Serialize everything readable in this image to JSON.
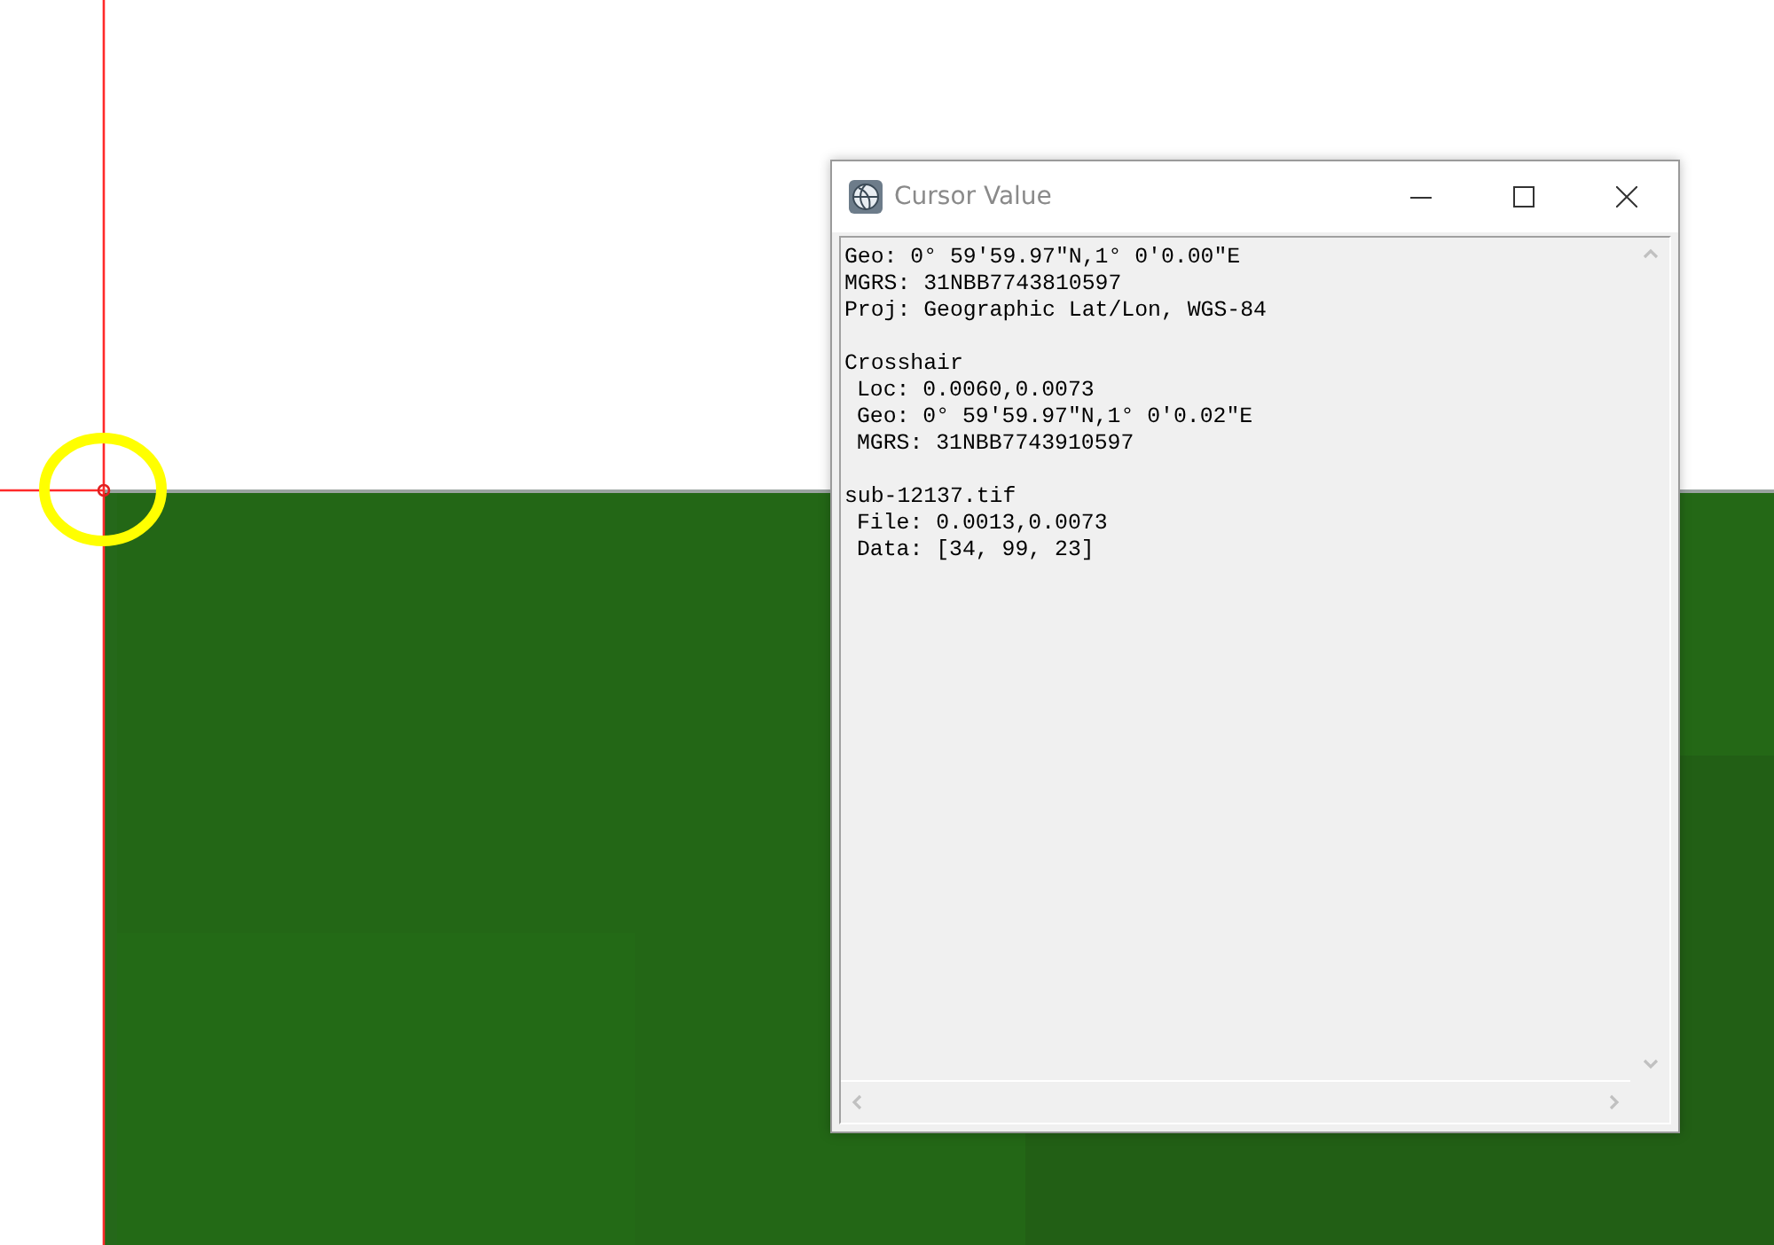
{
  "window": {
    "title": "Cursor Value"
  },
  "sections": [
    {
      "lines": [
        "Geo: 0° 59′59.97″N,1° 0′0.00″E",
        "MGRS: 31NBB7743810597",
        "Proj: Geographic Lat/Lon, WGS-84"
      ]
    },
    {
      "title": "Crosshair",
      "children": [
        "Loc: 0.0060,0.0073",
        "Geo: 0° 59′59.97″N,1° 0′0.02″E",
        "MGRS: 31NBB7743910597"
      ]
    },
    {
      "title": "sub-12137.tif",
      "children": [
        "File: 0.0013,0.0073",
        "Data: [34, 99, 23]"
      ]
    }
  ]
}
